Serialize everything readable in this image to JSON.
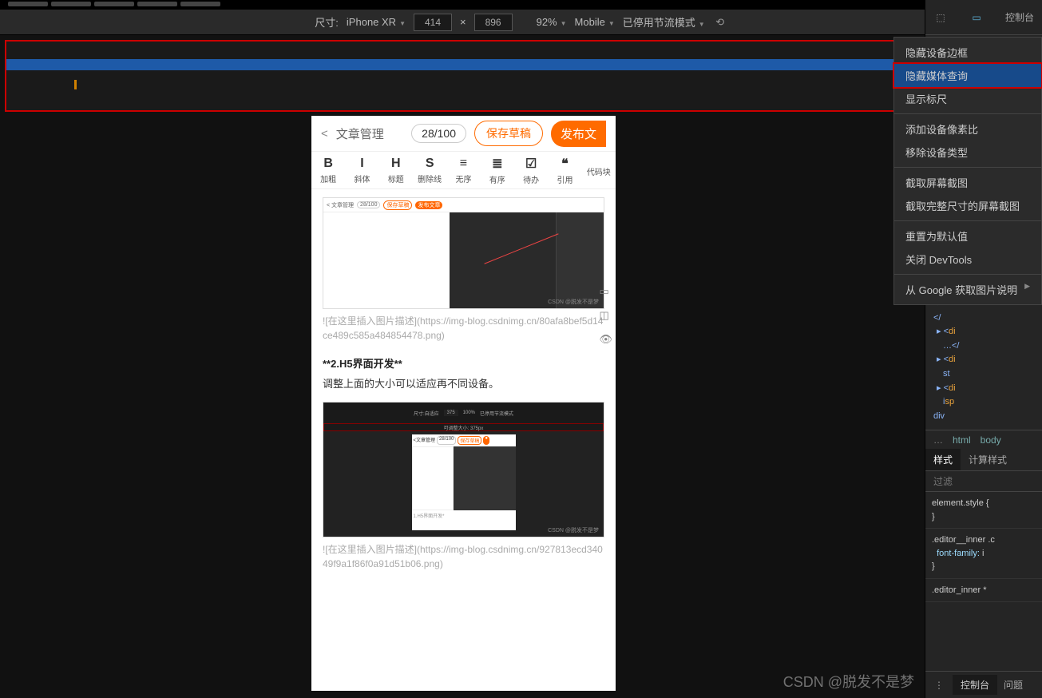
{
  "toolbar": {
    "dim_label": "尺寸:",
    "device": "iPhone XR",
    "width": "414",
    "height": "896",
    "zoom": "92%",
    "ua": "Mobile",
    "throttle": "已停用节流模式",
    "console_tab": "控制台"
  },
  "mobile": {
    "back": "文章管理",
    "counter": "28/100",
    "draft": "保存草稿",
    "publish": "发布文",
    "fmt": [
      {
        "g": "B",
        "l": "加粗"
      },
      {
        "g": "I",
        "l": "斜体"
      },
      {
        "g": "H",
        "l": "标题"
      },
      {
        "g": "S",
        "l": "删除线"
      },
      {
        "g": "≡",
        "l": "无序"
      },
      {
        "g": "≣",
        "l": "有序"
      },
      {
        "g": "☑",
        "l": "待办"
      },
      {
        "g": "❝",
        "l": "引用"
      },
      {
        "g": "</>",
        "l": "代码块"
      }
    ],
    "img1_cap": "![在这里插入图片描述](https://img-blog.csdnimg.cn/80afa8bef5d14ce489c585a484854478.png)",
    "section_title": "**2.H5界面开发**",
    "section_body": "调整上面的大小可以适应再不同设备。",
    "img2_cap": "![在这里插入图片描述](https://img-blog.csdnimg.cn/927813ecd34049f9a1f86f0a91d51b06.png)",
    "shot_wm": "CSDN @脱发不是梦",
    "shot_back": "< 文章管理",
    "shot_pct": "28/100",
    "shot_draft": "保存草稿",
    "shot_pub": "发布文章"
  },
  "context_menu": [
    "隐藏设备边框",
    "隐藏媒体查询",
    "显示标尺",
    "-",
    "添加设备像素比",
    "移除设备类型",
    "-",
    "截取屏幕截图",
    "截取完整尺寸的屏幕截图",
    "-",
    "重置为默认值",
    "关闭 DevTools",
    "-",
    "从 Google 获取图片说明"
  ],
  "context_hl_index": 1,
  "dev": {
    "crumb_html": "html",
    "crumb_body": "body",
    "tab_styles": "样式",
    "tab_computed": "计算样式",
    "filter": "过滤",
    "rule1": "element.style {",
    "rule1c": "}",
    "rule2": ".editor__inner .c",
    "rule2p": "font-family:",
    "rule2v": "i",
    "rule2c": "}",
    "rule3": ".editor_inner *",
    "drawer_tab": "控制台",
    "drawer_tab2": "问题",
    "tree": [
      "<",
      "</",
      "▸ <di",
      "…</",
      "▸ <di",
      "st",
      "▸ <di",
      "isp",
      "<!--",
      "</div"
    ]
  },
  "watermark": "CSDN @脱发不是梦"
}
